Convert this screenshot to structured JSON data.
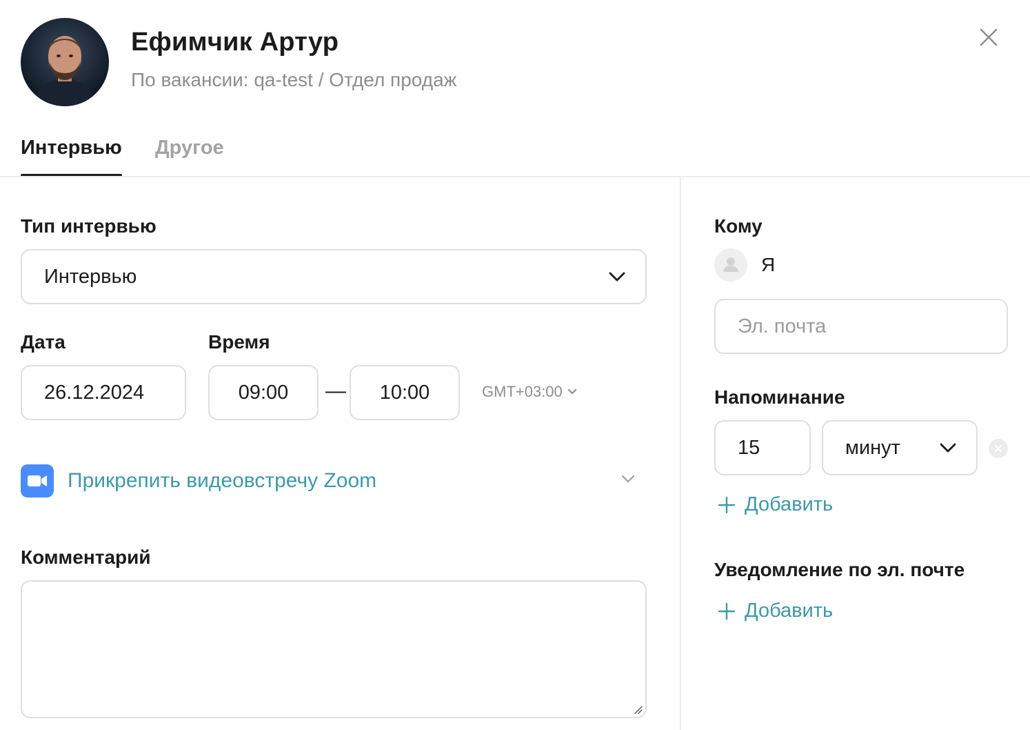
{
  "header": {
    "candidate_name": "Ефимчик Артур",
    "subtitle": "По вакансии: qa-test / Отдел продаж"
  },
  "tabs": [
    {
      "label": "Интервью",
      "active": true
    },
    {
      "label": "Другое",
      "active": false
    }
  ],
  "form": {
    "interview_type": {
      "label": "Тип интервью",
      "value": "Интервью"
    },
    "date": {
      "label": "Дата",
      "value": "26.12.2024"
    },
    "time": {
      "label": "Время",
      "start": "09:00",
      "separator": "—",
      "end": "10:00",
      "timezone": "GMT+03:00"
    },
    "zoom": {
      "label": "Прикрепить видеовстречу Zoom"
    },
    "comment": {
      "label": "Комментарий",
      "value": ""
    }
  },
  "sidebar": {
    "to": {
      "label": "Кому",
      "recipient": "Я",
      "email_placeholder": "Эл. почта"
    },
    "reminder": {
      "label": "Напоминание",
      "amount": "15",
      "unit": "минут",
      "add_label": "Добавить"
    },
    "email_notification": {
      "label": "Уведомление по эл. почте",
      "add_label": "Добавить"
    }
  },
  "colors": {
    "accent_link": "#3f98a8",
    "zoom_blue": "#4a8cff",
    "border": "#dedede",
    "muted_text": "#8d8d8d"
  },
  "icons": [
    "close-icon",
    "chevron-down-icon",
    "zoom-camera-icon",
    "user-icon",
    "plus-icon",
    "clear-icon",
    "resize-handle-icon"
  ]
}
